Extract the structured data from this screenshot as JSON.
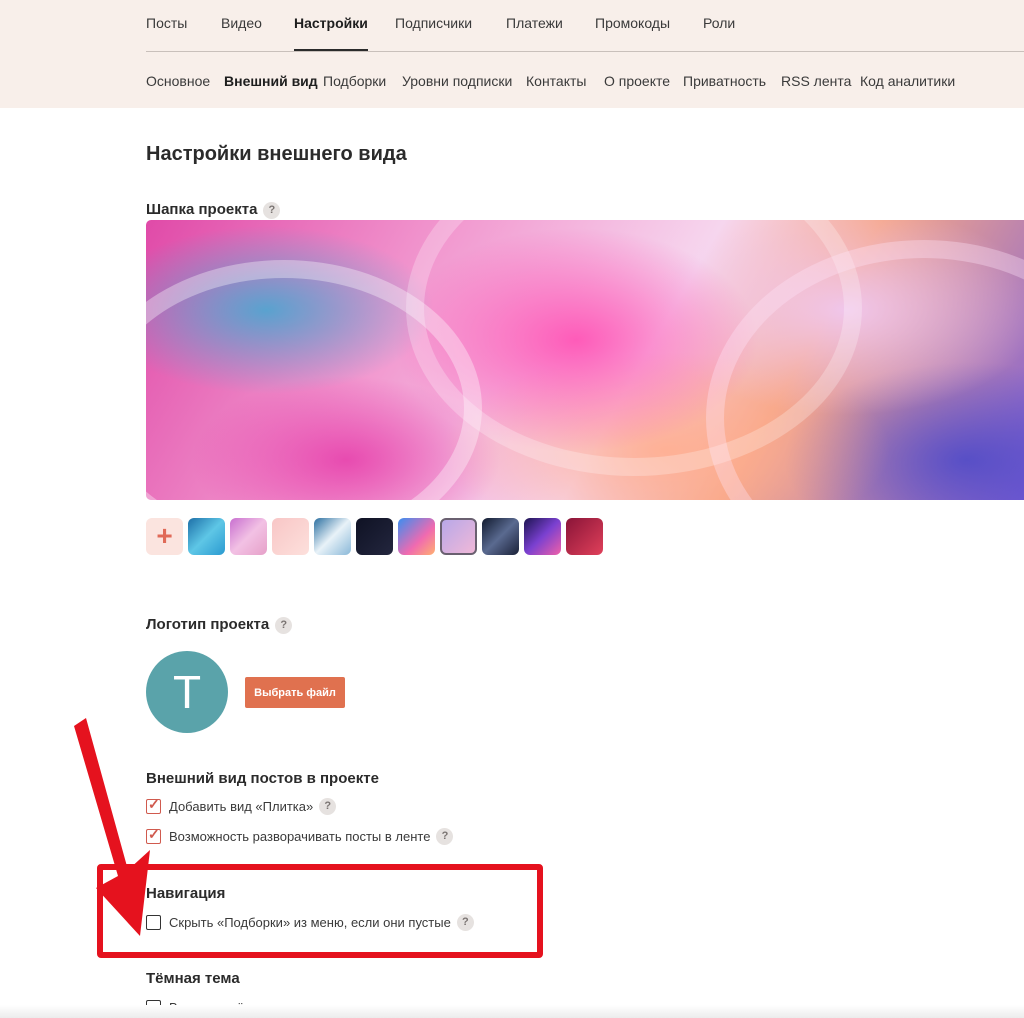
{
  "tabs_main": [
    {
      "label": "Посты"
    },
    {
      "label": "Видео"
    },
    {
      "label": "Настройки",
      "active": true
    },
    {
      "label": "Подписчики"
    },
    {
      "label": "Платежи"
    },
    {
      "label": "Промокоды"
    },
    {
      "label": "Роли"
    }
  ],
  "tabs_sub": [
    {
      "label": "Основное"
    },
    {
      "label": "Внешний вид",
      "active": true
    },
    {
      "label": "Подборки"
    },
    {
      "label": "Уровни подписки"
    },
    {
      "label": "Контакты"
    },
    {
      "label": "О проекте"
    },
    {
      "label": "Приватность"
    },
    {
      "label": "RSS лента"
    },
    {
      "label": "Код аналитики"
    }
  ],
  "page_title": "Настройки внешнего вида",
  "cover": {
    "label": "Шапка проекта",
    "add_symbol": "+",
    "selected_index": 7
  },
  "logo": {
    "label": "Логотип проекта",
    "avatar_letter": "T",
    "button_label": "Выбрать файл"
  },
  "posts_view": {
    "label": "Внешний вид постов в проекте",
    "option_tile": "Добавить вид «Плитка»",
    "option_expand": "Возможность разворачивать посты в ленте",
    "tile_checked": true,
    "expand_checked": true
  },
  "navigation": {
    "label": "Навигация",
    "option_hide": "Скрыть «Подборки» из меню, если они пустые",
    "hide_checked": false
  },
  "dark_theme": {
    "label": "Тёмная тема",
    "option_enable": "Включить тёмную тему в проекте",
    "enable_checked": false
  },
  "help_symbol": "?",
  "colors": {
    "accent": "#e0714f",
    "highlight": "#e5121e",
    "header_bg": "#f8efea",
    "avatar_bg": "#5aa3aa"
  }
}
